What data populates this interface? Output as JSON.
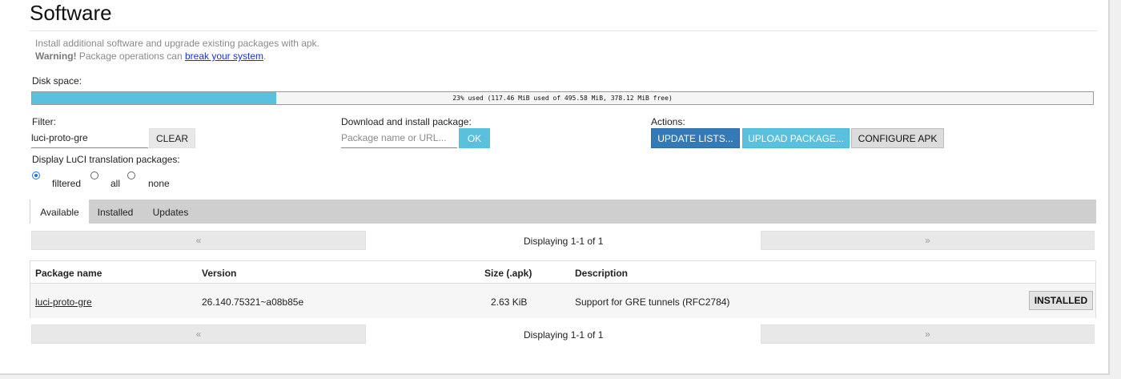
{
  "page": {
    "title": "Software",
    "description_line1": "Install additional software and upgrade existing packages with apk.",
    "warning_label": "Warning!",
    "warning_text": " Package operations can ",
    "warning_link": "break your system",
    "warning_end": "."
  },
  "disk": {
    "label": "Disk space:",
    "used_fraction": 0.23,
    "text": "23% used (117.46 MiB used of 495.58 MiB, 378.12 MiB free)"
  },
  "filter": {
    "label": "Filter:",
    "value": "luci-proto-gre",
    "clear_label": "CLEAR"
  },
  "download": {
    "label": "Download and install package:",
    "placeholder": "Package name or URL...",
    "ok_label": "OK"
  },
  "actions": {
    "label": "Actions:",
    "update_label": "UPDATE LISTS...",
    "upload_label": "UPLOAD PACKAGE...",
    "configure_label": "CONFIGURE APK"
  },
  "translation": {
    "label": "Display LuCI translation packages:",
    "options": [
      "filtered",
      "all",
      "none"
    ],
    "selected": "filtered"
  },
  "tabs": [
    "Available",
    "Installed",
    "Updates"
  ],
  "active_tab": "Available",
  "pager": {
    "prev": "«",
    "next": "»",
    "status": "Displaying 1-1 of 1"
  },
  "table": {
    "headers": [
      "Package name",
      "Version",
      "Size (.apk)",
      "Description"
    ],
    "rows": [
      {
        "name": "luci-proto-gre",
        "version": "26.140.75321~a08b85e",
        "size": "2.63 KiB",
        "description": "Support for GRE tunnels (RFC2784)",
        "action": "INSTALLED"
      }
    ]
  },
  "colors": {
    "disk_fill": "#5bc0de",
    "primary": "#337ab7",
    "info": "#5bc0de",
    "tab_bar": "#cfcfcf"
  }
}
